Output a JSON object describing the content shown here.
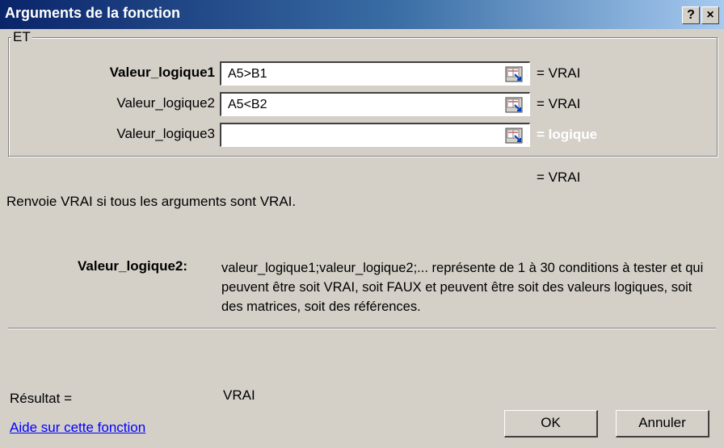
{
  "window": {
    "title": "Arguments de la fonction",
    "help_btn": "?",
    "close_btn": "×"
  },
  "function_name": "ET",
  "args": [
    {
      "label": "Valeur_logique1",
      "value": "A5>B1",
      "result": "= VRAI"
    },
    {
      "label": "Valeur_logique2",
      "value": "A5<B2",
      "result": "= VRAI"
    },
    {
      "label": "Valeur_logique3",
      "value": "",
      "result": "= logique"
    }
  ],
  "overall_result": "= VRAI",
  "description": "Renvoie VRAI si tous les arguments sont VRAI.",
  "arg_help": {
    "name": "Valeur_logique2:",
    "text": "valeur_logique1;valeur_logique2;... représente de 1 à 30 conditions à tester et qui peuvent être soit VRAI, soit FAUX et peuvent être soit des valeurs logiques, soit des matrices, soit des références."
  },
  "result": {
    "label": "Résultat =",
    "value": "VRAI"
  },
  "help_link": "Aide sur cette fonction",
  "buttons": {
    "ok": "OK",
    "cancel": "Annuler"
  }
}
